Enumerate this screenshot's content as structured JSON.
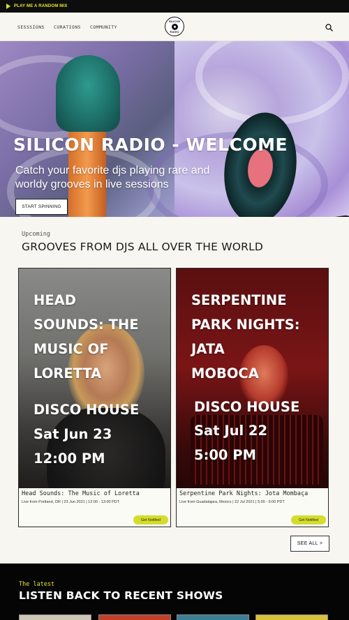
{
  "topbar": {
    "label": "PLAY ME A RANDOM MIX",
    "accent_color": "#e4ea2a"
  },
  "nav": {
    "links": [
      "SESSSIONS",
      "CURATIONS",
      "COMMUNITY"
    ],
    "logo_text": "SILICON RADIO",
    "search_icon": "search-icon"
  },
  "hero": {
    "title": "SILICON RADIO - WELCOME",
    "subtitle": "Catch your favorite djs playing rare and worldy grooves in live sessions",
    "cta": "START SPINNING"
  },
  "upcoming": {
    "kicker": "Upcoming",
    "title": "GROOVES FROM DJS ALL OVER THE WORLD",
    "cards": [
      {
        "overlay_lines": [
          "HEAD",
          "SOUNDS: THE",
          "MUSIC OF",
          "LORETTA"
        ],
        "genre": "DISCO HOUSE",
        "date": "Sat Jun 23",
        "time": "12:00 PM",
        "name": "Head Sounds: The Music of Loretta",
        "meta": "Live from Portland, OR | 23 Jun 2021 | 12:00 - 13:00 PDT",
        "button": "Get Notified"
      },
      {
        "overlay_lines": [
          "SERPENTINE",
          "PARK NIGHTS:",
          "JATA",
          "MOBOCA"
        ],
        "genre": "DISCO HOUSE",
        "date": "Sat Jul 22",
        "time": "5:00 PM",
        "name": "Serpentine Park Nights: Jota Mombaça",
        "meta": "Live from Guadalajara, Mexico | 22 Jul 2021 | 5:00 - 6:00 PDT",
        "button": "Get Notified"
      }
    ],
    "see_all": "SEE ALL >"
  },
  "latest": {
    "kicker": "The latest",
    "title": "LISTEN BACK TO RECENT SHOWS"
  },
  "colors": {
    "accent_yellow": "#d4dd2b",
    "dark": "#050505",
    "background": "#f7f6f0"
  }
}
